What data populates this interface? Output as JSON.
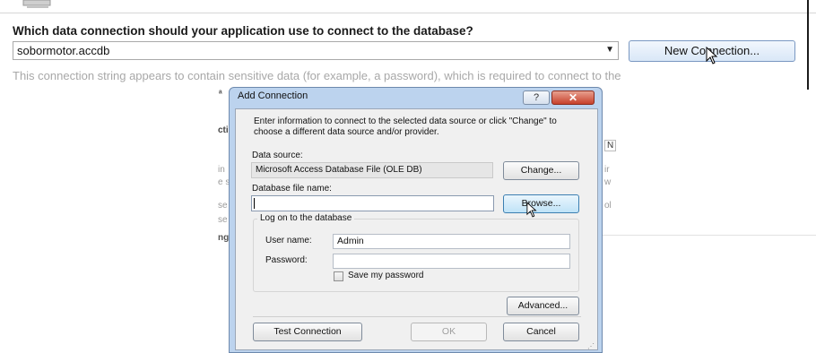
{
  "wizard": {
    "question": "Which data connection should your application use to connect to the database?",
    "connection_value": "sobormotor.accdb",
    "new_connection_label": "New Connection...",
    "sensitive_note": "This connection string appears to contain sensitive data (for example, a password), which is required to connect to the"
  },
  "dialog": {
    "title": "Add Connection",
    "help_glyph": "?",
    "close_glyph": "✕",
    "instructions": "Enter information to connect to the selected data source or click \"Change\" to choose a different data source and/or provider.",
    "data_source_label": "Data source:",
    "data_source_value": "Microsoft Access Database File (OLE DB)",
    "change_label": "Change...",
    "db_file_label": "Database file name:",
    "db_file_value": "",
    "browse_label": "Browse...",
    "logon_group_label": "Log on to the database",
    "user_name_label": "User name:",
    "user_name_value": "Admin",
    "password_label": "Password:",
    "password_value": "",
    "save_password_label": "Save my password",
    "advanced_label": "Advanced...",
    "test_connection_label": "Test Connection",
    "ok_label": "OK",
    "cancel_label": "Cancel"
  }
}
